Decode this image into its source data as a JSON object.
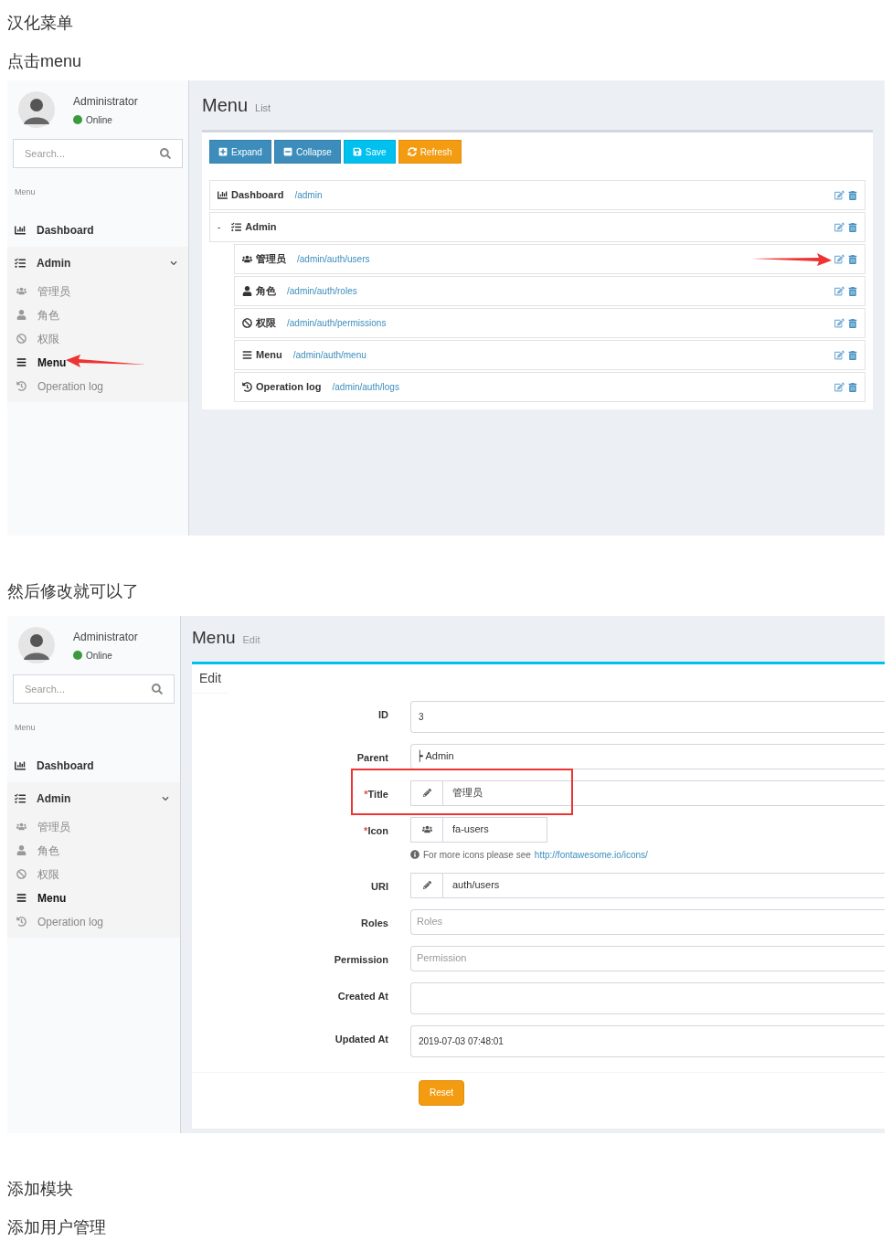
{
  "blocks": [
    {
      "kind": "text",
      "text": "汉化菜单"
    },
    {
      "kind": "text",
      "text": "点击menu"
    },
    {
      "kind": "list_screen",
      "sidebar": {
        "user": {
          "name": "Administrator",
          "status": "Online"
        },
        "search": {
          "placeholder": "Search..."
        },
        "header": "Menu",
        "items": [
          {
            "label": "Dashboard",
            "selected": false,
            "pointed": false
          },
          {
            "label": "Admin",
            "selected": false,
            "expanded": true,
            "pointed": false,
            "children": [
              {
                "label": "管理员",
                "selected": false,
                "pointed": false
              },
              {
                "label": "角色",
                "selected": false,
                "pointed": false
              },
              {
                "label": "权限",
                "selected": false,
                "pointed": false
              },
              {
                "label": "Menu",
                "selected": true,
                "pointed": true
              },
              {
                "label": "Operation log",
                "selected": false,
                "pointed": false
              }
            ]
          }
        ]
      },
      "page": {
        "title": "Menu",
        "subtitle": "List"
      },
      "toolbar": [
        {
          "label": "Expand",
          "kind": "primary"
        },
        {
          "label": "Collapse",
          "kind": "primary"
        },
        {
          "label": "Save",
          "kind": "info"
        },
        {
          "label": "Refresh",
          "kind": "warning"
        }
      ],
      "tree": [
        {
          "title": "Dashboard",
          "uri": "/admin",
          "pointed": false
        },
        {
          "title": "Admin",
          "toggle": "-",
          "pointed": false,
          "children": [
            {
              "title": "管理员",
              "uri": "/admin/auth/users",
              "pointed": true
            },
            {
              "title": "角色",
              "uri": "/admin/auth/roles",
              "pointed": false
            },
            {
              "title": "权限",
              "uri": "/admin/auth/permissions",
              "pointed": false
            },
            {
              "title": "Menu",
              "uri": "/admin/auth/menu",
              "pointed": false
            },
            {
              "title": "Operation log",
              "uri": "/admin/auth/logs",
              "pointed": false
            }
          ]
        }
      ]
    },
    {
      "kind": "text",
      "text": "然后修改就可以了"
    },
    {
      "kind": "edit_screen",
      "sidebar": {
        "user": {
          "name": "Administrator",
          "status": "Online"
        },
        "search": {
          "placeholder": "Search..."
        },
        "header": "Menu",
        "items": [
          {
            "label": "Dashboard",
            "selected": false,
            "pointed": false
          },
          {
            "label": "Admin",
            "selected": false,
            "expanded": true,
            "pointed": false,
            "children": [
              {
                "label": "管理员",
                "selected": false,
                "pointed": false
              },
              {
                "label": "角色",
                "selected": false,
                "pointed": false
              },
              {
                "label": "权限",
                "selected": false,
                "pointed": false
              },
              {
                "label": "Menu",
                "selected": true,
                "pointed": false
              },
              {
                "label": "Operation log",
                "selected": false,
                "pointed": false
              }
            ]
          }
        ]
      },
      "page": {
        "title": "Menu",
        "subtitle": "Edit"
      },
      "form": {
        "title": "Edit",
        "fields": [
          {
            "label": "ID",
            "kind": "text",
            "highlighted": false,
            "value": "3"
          },
          {
            "label": "Parent",
            "kind": "select",
            "highlighted": false,
            "value": "┝ Admin"
          },
          {
            "label": "Title",
            "kind": "pencil",
            "marker": "*",
            "highlighted": true,
            "value": "管理员"
          },
          {
            "label": "Icon",
            "kind": "icon",
            "marker": "*",
            "highlighted": false,
            "value": "fa-users",
            "help": {
              "text": "For more icons please see",
              "link": "http://fontawesome.io/icons/"
            }
          },
          {
            "label": "URI",
            "kind": "pencil",
            "highlighted": false,
            "value": "auth/users"
          },
          {
            "label": "Roles",
            "kind": "select",
            "highlighted": false,
            "placeholder": "Roles"
          },
          {
            "label": "Permission",
            "kind": "select",
            "highlighted": false,
            "placeholder": "Permission"
          },
          {
            "label": "Created At",
            "kind": "text",
            "highlighted": false
          },
          {
            "label": "Updated At",
            "kind": "text",
            "highlighted": false,
            "value": "2019-07-03 07:48:01"
          }
        ],
        "reset": "Reset"
      }
    },
    {
      "kind": "text",
      "text": "添加模块"
    },
    {
      "kind": "text",
      "text": "添加用户管理"
    }
  ]
}
